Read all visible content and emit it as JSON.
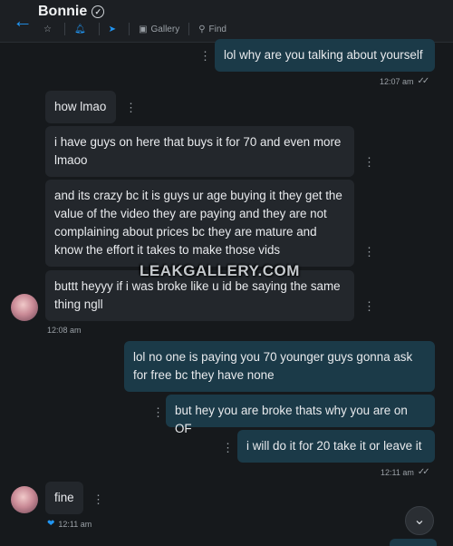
{
  "header": {
    "title": "Bonnie",
    "gallery_label": "Gallery",
    "find_label": "Find"
  },
  "messages": [
    {
      "side": "out",
      "text": "lol why are you talking about yourself"
    },
    {
      "side": "in",
      "text": "how lmao"
    },
    {
      "side": "in",
      "text": "i have guys on here that buys it for 70 and even more lmaoo"
    },
    {
      "side": "in",
      "text": "and its crazy bc it is guys ur age buying it they get the value of the video they are paying and they are not complaining about prices bc they are mature and know the effort it takes to make those vids"
    },
    {
      "side": "in",
      "text": "buttt heyyy if i was broke like u id be saying the same thing ngll"
    },
    {
      "side": "out",
      "text": "lol no one is paying you 70 younger guys gonna ask for free bc they have none"
    },
    {
      "side": "out",
      "text": "but hey you are broke thats why you are on OF"
    },
    {
      "side": "out",
      "text": "i will do it for 20 take it or leave it"
    },
    {
      "side": "in",
      "text": "fine"
    }
  ],
  "timestamps": {
    "t1": "12:07 am",
    "t2": "12:08 am",
    "t3": "12:11 am",
    "t4": "12:11 am"
  },
  "watermark": "LEAKGALLERY.COM",
  "colors": {
    "accent": "#2196f3",
    "incoming_bubble": "#23272c",
    "outgoing_bubble": "#1b3a48",
    "background": "#16191c"
  }
}
